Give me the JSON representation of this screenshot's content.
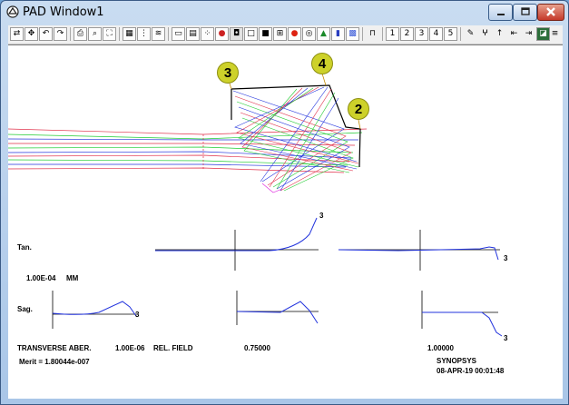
{
  "window": {
    "title": "PAD Window1",
    "controls": {
      "minimize_icon": "minimize-icon",
      "maximize_icon": "maximize-icon",
      "close_icon": "close-icon"
    }
  },
  "toolbar": {
    "number_buttons": [
      "1",
      "2",
      "3",
      "4",
      "5"
    ],
    "icons": [
      "swap-icon",
      "move-icon",
      "undo-icon",
      "redo-icon",
      "print-icon",
      "print-preview-icon",
      "zoom-fit-icon",
      "film-icon",
      "grid-icon",
      "label-icon",
      "table-icon",
      "scale-icon",
      "dots-icon",
      "frame-filled-icon",
      "frame-empty-icon",
      "square-icon",
      "zoom-box-icon",
      "red-dot-icon",
      "ring-icon",
      "mountain-icon",
      "bars-icon",
      "hatch-icon",
      "ruler-icon",
      "pencil-icon",
      "wizard-icon",
      "up-arrow-icon",
      "first-icon",
      "last-icon",
      "image-icon",
      "spot-icon",
      "vtheta-icon",
      "close-x-icon",
      "menu-icon"
    ]
  },
  "diagram": {
    "callouts": [
      "3",
      "4",
      "2"
    ],
    "colors": {
      "blue": "#2233dd",
      "red": "#e0304a",
      "green": "#22cc33",
      "magenta": "#dd22dd",
      "black": "#000000",
      "callout": "#cdd12a"
    }
  },
  "aberration": {
    "tan_label": "Tan.",
    "sag_label": "Sag.",
    "scale_value": "1.00E-04",
    "scale_unit": "MM",
    "curve_tags": [
      "3",
      "3",
      "3",
      "3"
    ],
    "footer": {
      "title": "TRANSVERSE ABER.",
      "precision": "1.00E-06",
      "rel_field_label": "REL. FIELD",
      "field_1": "0.75000",
      "field_2": "1.00000",
      "merit": "Merit = 1.80044e-007",
      "company": "SYNOPSYS",
      "datetime": "08-APR-19  00:01:48"
    }
  }
}
